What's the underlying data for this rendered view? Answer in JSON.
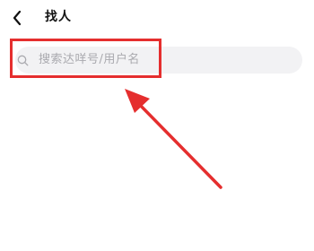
{
  "header": {
    "back_icon": "chevron-left-icon",
    "title": "找人"
  },
  "search": {
    "icon": "search-icon",
    "placeholder": "搜索达咩号/用户名"
  },
  "annotation": {
    "highlight_color": "#e52e2e",
    "arrow_color": "#e52e2e"
  }
}
